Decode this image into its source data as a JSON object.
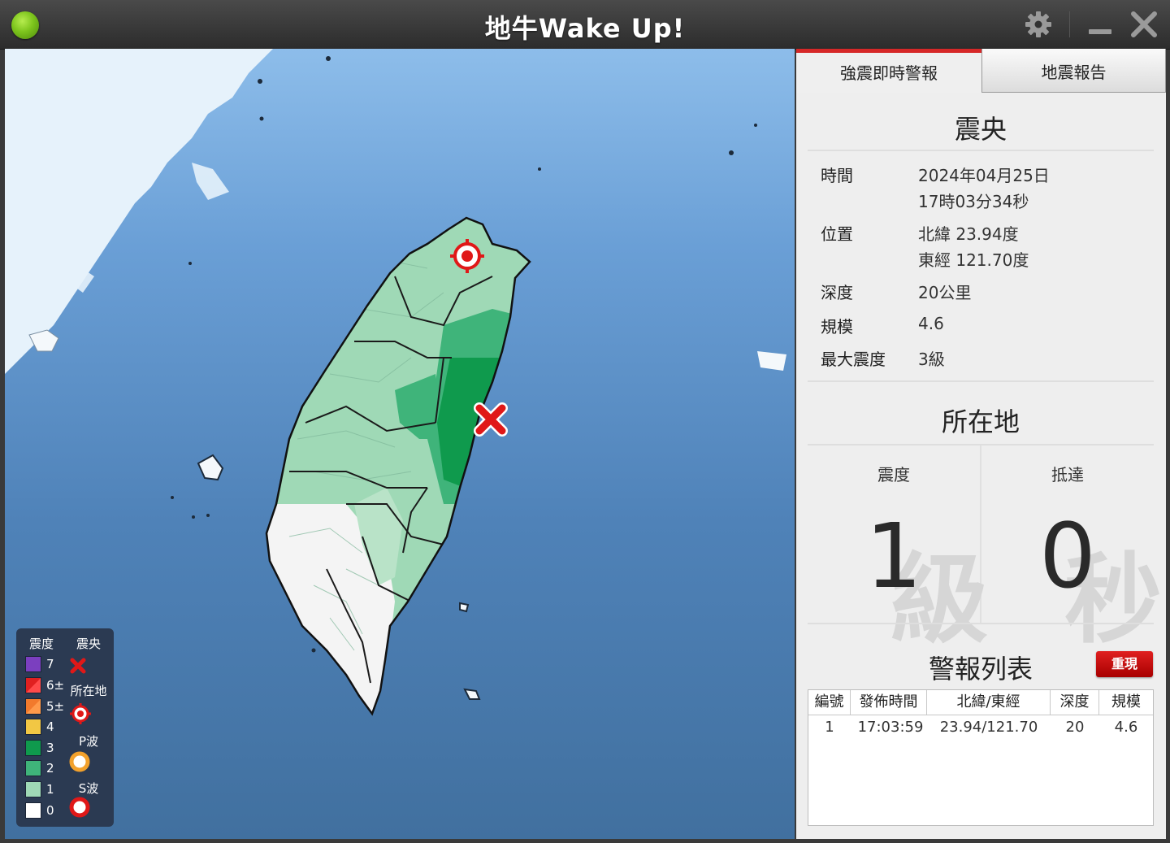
{
  "window": {
    "title": "地牛Wake Up!",
    "status_icon": "green-status-dot",
    "settings_icon": "gear-icon",
    "minimize_icon": "minimize-icon",
    "close_icon": "close-icon"
  },
  "tabs": [
    {
      "label": "強震即時警報",
      "active": true
    },
    {
      "label": "地震報告",
      "active": false
    }
  ],
  "epicenter": {
    "title": "震央",
    "rows": [
      {
        "label": "時間",
        "value": "2024年04月25日",
        "value2": "17時03分34秒"
      },
      {
        "label": "位置",
        "value": "北緯 23.94度",
        "value2": "東經 121.70度"
      },
      {
        "label": "深度",
        "value": "20公里"
      },
      {
        "label": "規模",
        "value": "4.6"
      },
      {
        "label": "最大震度",
        "value": "3級"
      }
    ]
  },
  "location": {
    "title": "所在地",
    "intensity_label": "震度",
    "intensity_value": "1",
    "intensity_unit": "級",
    "arrival_label": "抵達",
    "arrival_value": "0",
    "arrival_unit": "秒"
  },
  "alerts": {
    "title": "警報列表",
    "replay_label": "重現",
    "columns": [
      "編號",
      "發佈時間",
      "北緯/東經",
      "深度",
      "規模"
    ],
    "rows": [
      [
        "1",
        "17:03:59",
        "23.94/121.70",
        "20",
        "4.6"
      ]
    ]
  },
  "legend": {
    "intensity_header": "震度",
    "epicenter_header": "震央",
    "location_label": "所在地",
    "p_wave_label": "P波",
    "s_wave_label": "S波",
    "levels": [
      {
        "label": "7",
        "color": "#7b3fbf"
      },
      {
        "label": "6±",
        "color": "#e02020"
      },
      {
        "label": "5±",
        "color": "#f27a2c"
      },
      {
        "label": "4",
        "color": "#f2c744"
      },
      {
        "label": "3",
        "color": "#0f9a4d"
      },
      {
        "label": "2",
        "color": "#3fb47a"
      },
      {
        "label": "1",
        "color": "#9fd9b6"
      },
      {
        "label": "0",
        "color": "#ffffff"
      }
    ]
  },
  "colors": {
    "accent_red": "#d62828",
    "intensity_3": "#0f9a4d",
    "intensity_2": "#3fb47a",
    "intensity_1": "#9fd9b6",
    "intensity_0": "#f4f4f4"
  }
}
